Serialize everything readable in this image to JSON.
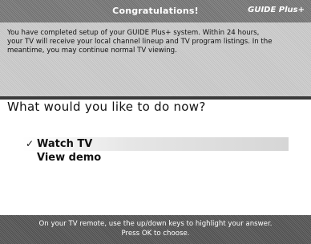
{
  "header": {
    "title": "Congratulations!",
    "logo": "GUIDE Plus+"
  },
  "message": {
    "line1": "You have completed setup of your GUIDE Plus+ system. Within 24 hours,",
    "line2": "your TV will receive your local channel lineup and TV program listings. In the",
    "line3": "meantime, you may continue normal TV viewing."
  },
  "question": "What would you like to do now?",
  "menu": {
    "items": [
      {
        "label": "Watch TV",
        "selected": true,
        "check": "✓"
      },
      {
        "label": "View demo",
        "selected": false
      }
    ]
  },
  "footer": {
    "line1": "On your TV remote, use the up/down keys to highlight your answer.",
    "line2": "Press OK to choose."
  },
  "colors": {
    "header_bg": "#7c7c7c",
    "panel_bg": "#cacaca",
    "footer_bg": "#5c5c5c",
    "divider": "#3a3a3a"
  }
}
